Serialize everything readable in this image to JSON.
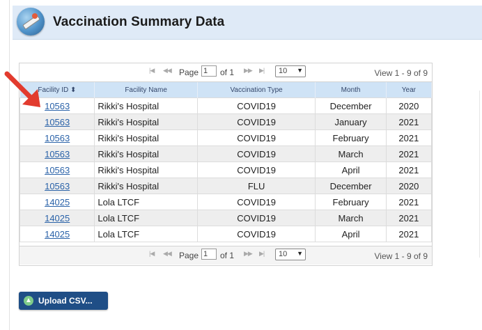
{
  "header": {
    "title": "Vaccination Summary Data",
    "icon": "vaccine-icon"
  },
  "pager_top": {
    "page_label": "Page",
    "page_value": "1",
    "of_label": "of 1",
    "rows_per_page": "10",
    "view_info": "View 1 - 9 of 9"
  },
  "pager_bottom": {
    "page_label": "Page",
    "page_value": "1",
    "of_label": "of 1",
    "rows_per_page": "10",
    "view_info": "View 1 - 9 of 9"
  },
  "table": {
    "columns": [
      "Facility ID ⬍",
      "Facility Name",
      "Vaccination Type",
      "Month",
      "Year"
    ],
    "rows": [
      {
        "id": "10563",
        "name": "Rikki's Hospital",
        "type": "COVID19",
        "month": "December",
        "year": "2020"
      },
      {
        "id": "10563",
        "name": "Rikki's Hospital",
        "type": "COVID19",
        "month": "January",
        "year": "2021"
      },
      {
        "id": "10563",
        "name": "Rikki's Hospital",
        "type": "COVID19",
        "month": "February",
        "year": "2021"
      },
      {
        "id": "10563",
        "name": "Rikki's Hospital",
        "type": "COVID19",
        "month": "March",
        "year": "2021"
      },
      {
        "id": "10563",
        "name": "Rikki's Hospital",
        "type": "COVID19",
        "month": "April",
        "year": "2021"
      },
      {
        "id": "10563",
        "name": "Rikki's Hospital",
        "type": "FLU",
        "month": "December",
        "year": "2020"
      },
      {
        "id": "14025",
        "name": "Lola LTCF",
        "type": "COVID19",
        "month": "February",
        "year": "2021"
      },
      {
        "id": "14025",
        "name": "Lola LTCF",
        "type": "COVID19",
        "month": "March",
        "year": "2021"
      },
      {
        "id": "14025",
        "name": "Lola LTCF",
        "type": "COVID19",
        "month": "April",
        "year": "2021"
      }
    ]
  },
  "upload_button": {
    "label": "Upload CSV..."
  },
  "colors": {
    "header_bg": "#dfeaf7",
    "table_header_bg": "#cfe3f6",
    "link": "#2a62a8",
    "button_bg": "#1f4e86",
    "arrow": "#e23b2e"
  }
}
